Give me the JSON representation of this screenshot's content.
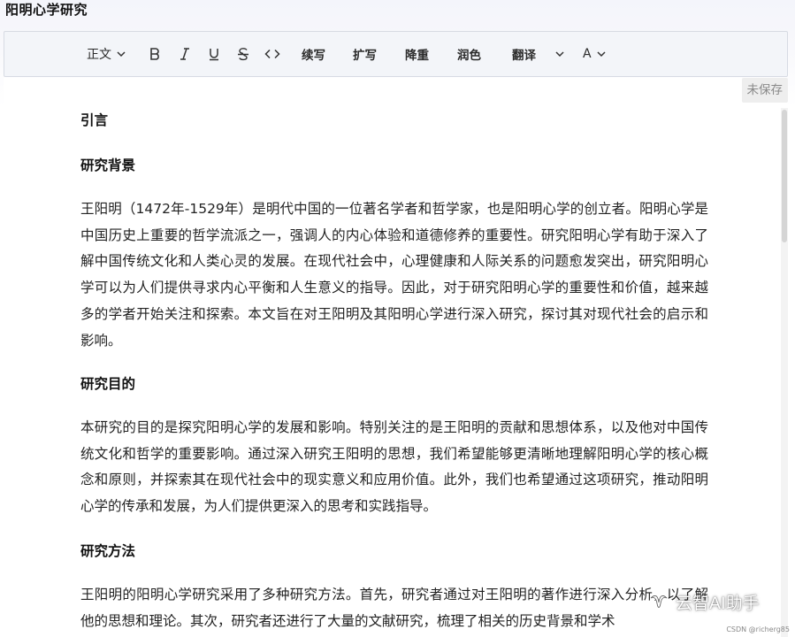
{
  "document": {
    "title": "阳明心学研究"
  },
  "toolbar": {
    "style_select": "正文",
    "bold_icon": "bold-icon",
    "italic_icon": "italic-icon",
    "underline_icon": "underline-icon",
    "strike_icon": "strikethrough-icon",
    "code_icon": "code-icon",
    "ai_actions": [
      "续写",
      "扩写",
      "降重",
      "润色",
      "翻译"
    ],
    "font_color_label": "A"
  },
  "status": {
    "save_state": "未保存"
  },
  "content": {
    "sections": [
      {
        "heading": "引言"
      },
      {
        "heading": "研究背景",
        "paragraph": "王阳明（1472年-1529年）是明代中国的一位著名学者和哲学家，也是阳明心学的创立者。阳明心学是中国历史上重要的哲学流派之一，强调人的内心体验和道德修养的重要性。研究阳明心学有助于深入了解中国传统文化和人类心灵的发展。在现代社会中，心理健康和人际关系的问题愈发突出，研究阳明心学可以为人们提供寻求内心平衡和人生意义的指导。因此，对于研究阳明心学的重要性和价值，越来越多的学者开始关注和探索。本文旨在对王阳明及其阳明心学进行深入研究，探讨其对现代社会的启示和影响。"
      },
      {
        "heading": "研究目的",
        "paragraph": "本研究的目的是探究阳明心学的发展和影响。特别关注的是王阳明的贡献和思想体系，以及他对中国传统文化和哲学的重要影响。通过深入研究王阳明的思想，我们希望能够更清晰地理解阳明心学的核心概念和原则，并探索其在现代社会中的现实意义和应用价值。此外，我们也希望通过这项研究，推动阳明心学的传承和发展，为人们提供更深入的思考和实践指导。"
      },
      {
        "heading": "研究方法",
        "paragraph": "王阳明的阳明心学研究采用了多种研究方法。首先，研究者通过对王阳明的著作进行深入分析，以了解他的思想和理论。其次，研究者还进行了大量的文献研究，梳理了相关的历史背景和学术"
      }
    ]
  },
  "watermark": {
    "text": "云智AI助手",
    "credit": "CSDN @richerg85"
  }
}
